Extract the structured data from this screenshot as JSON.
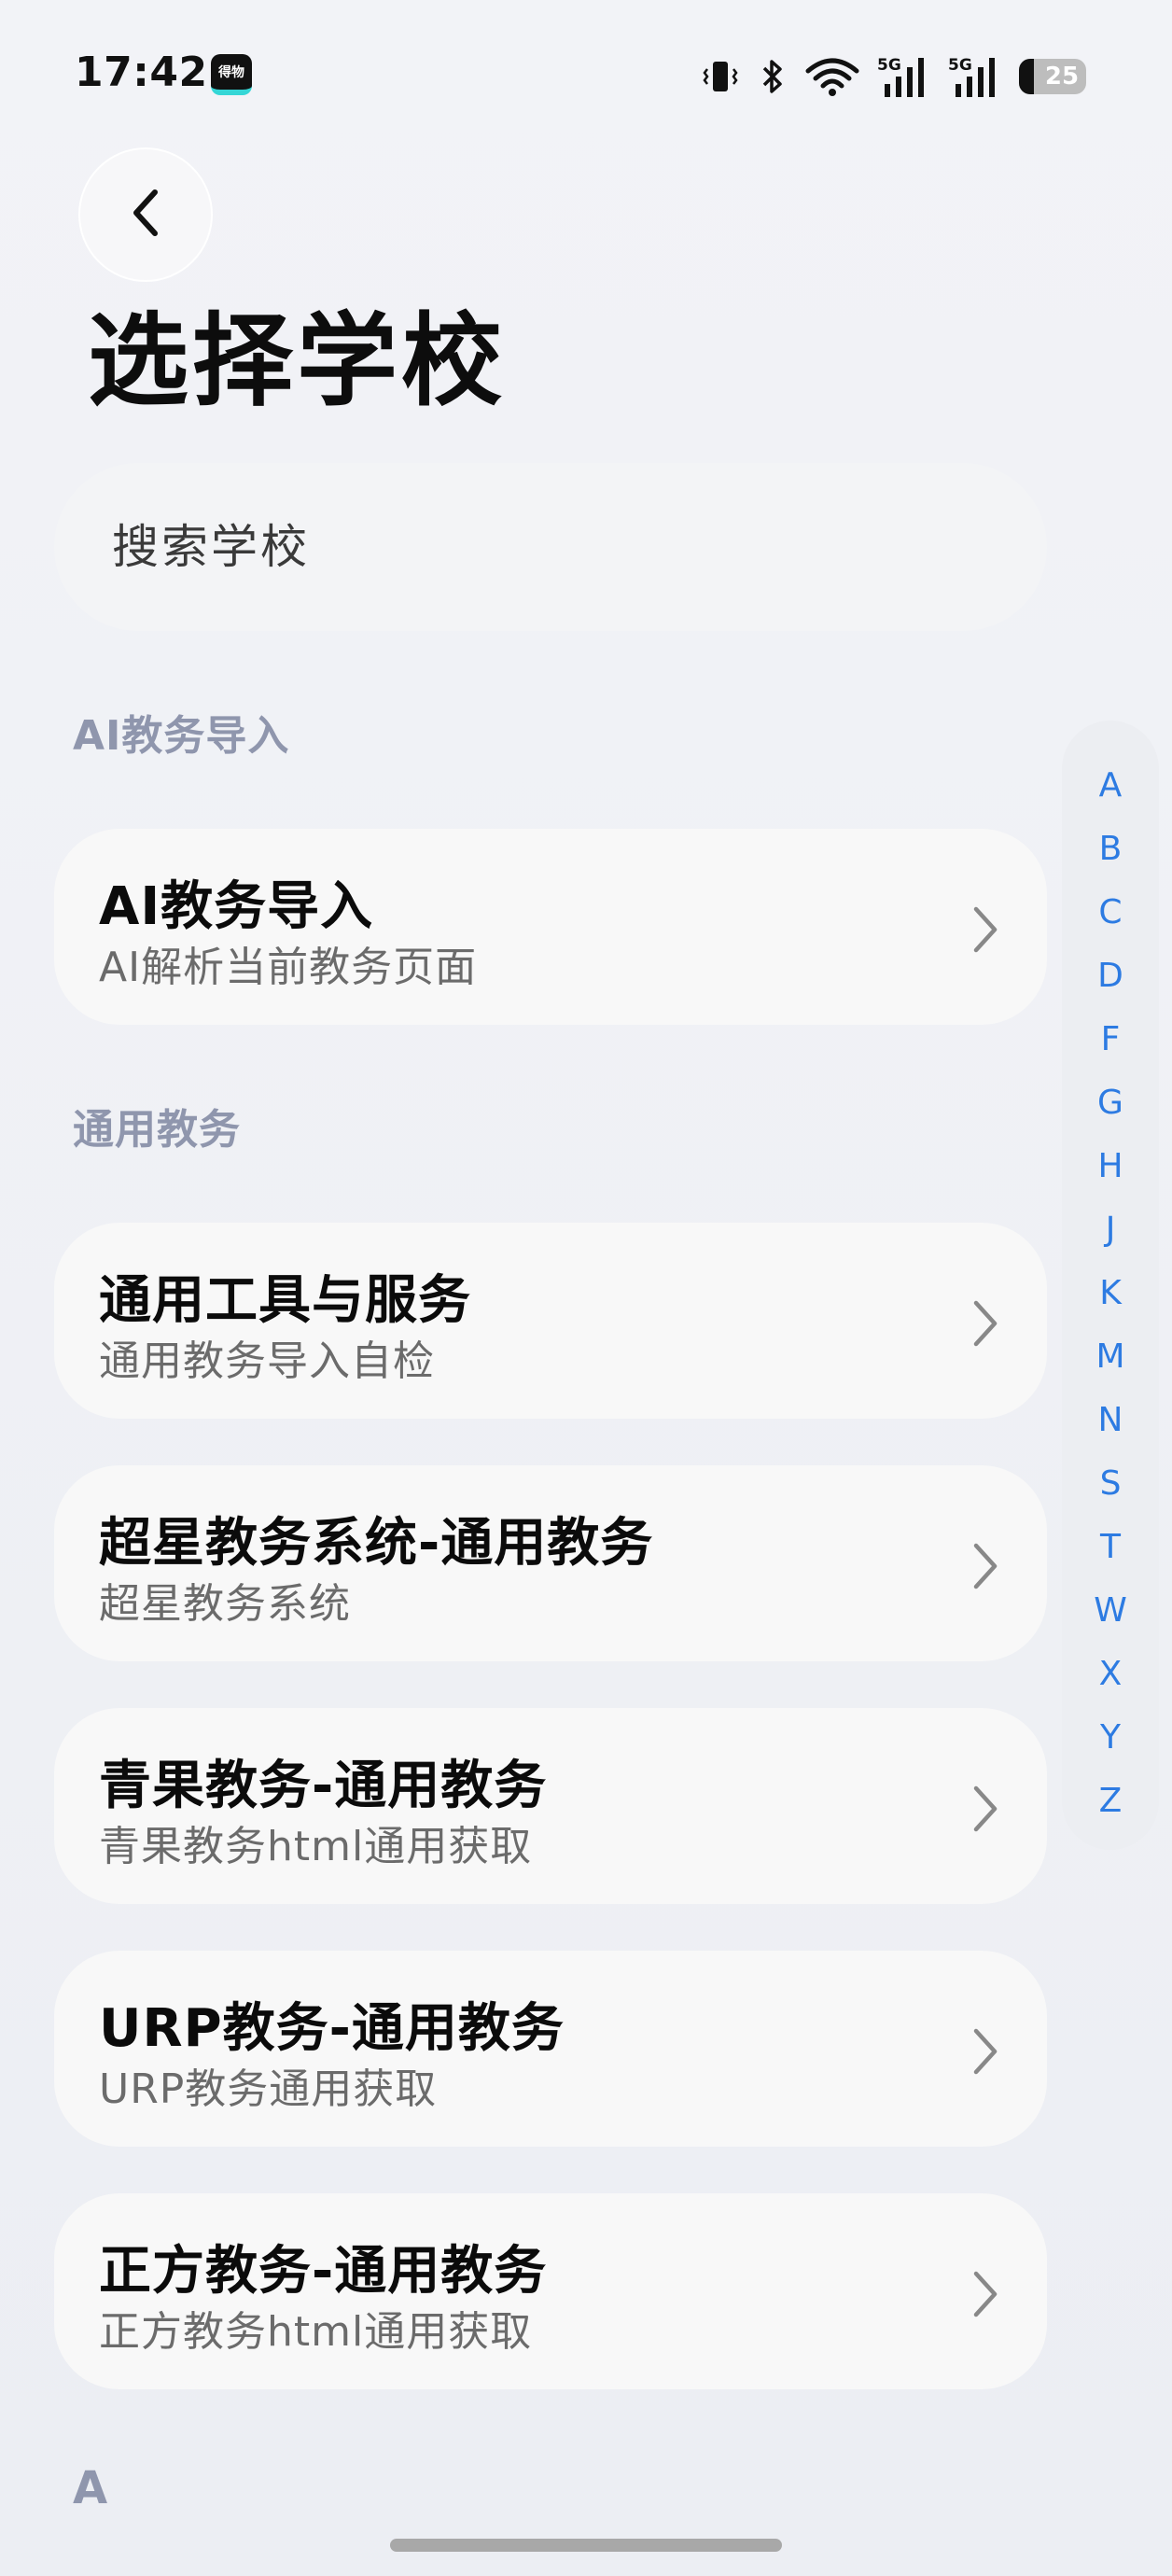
{
  "status_bar": {
    "time": "17:42",
    "app_icon_text": "得物",
    "battery": "25",
    "icons": [
      "vibrate-icon",
      "bluetooth-icon",
      "wifi-icon",
      "signal-5g-icon",
      "signal-5g-icon",
      "battery-icon"
    ]
  },
  "header": {
    "back_icon": "chevron-left-icon",
    "title": "选择学校"
  },
  "search": {
    "placeholder": "搜索学校"
  },
  "sections": [
    {
      "header": "AI教务导入",
      "items": [
        {
          "title": "AI教务导入",
          "subtitle": "AI解析当前教务页面"
        }
      ]
    },
    {
      "header": "通用教务",
      "items": [
        {
          "title": "通用工具与服务",
          "subtitle": "通用教务导入自检"
        },
        {
          "title": "超星教务系统-通用教务",
          "subtitle": "超星教务系统"
        },
        {
          "title": "青果教务-通用教务",
          "subtitle": "青果教务html通用获取"
        },
        {
          "title": "URP教务-通用教务",
          "subtitle": "URP教务通用获取"
        },
        {
          "title": "正方教务-通用教务",
          "subtitle": "正方教务html通用获取"
        }
      ]
    },
    {
      "header": "A",
      "items": []
    }
  ],
  "alpha_index": [
    "A",
    "B",
    "C",
    "D",
    "F",
    "G",
    "H",
    "J",
    "K",
    "M",
    "N",
    "S",
    "T",
    "W",
    "X",
    "Y",
    "Z"
  ],
  "colors": {
    "accent": "#2d7be2",
    "section_header": "#8f96ad",
    "card_bg": "#f8f8f8"
  }
}
